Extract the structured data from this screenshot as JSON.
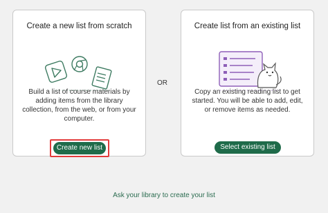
{
  "left_card": {
    "title": "Create a new list from scratch",
    "description": "Build a list of course materials by adding items from the library collection, from the web, or from your computer.",
    "button_label": "Create new list",
    "illustration_icons": [
      "play-icon",
      "chrome-icon",
      "document-icon"
    ]
  },
  "separator_label": "OR",
  "right_card": {
    "title": "Create list from an existing list",
    "description": "Copy an existing reading list to get started. You will be able to add, edit, or remove items as needed.",
    "button_label": "Select existing list",
    "illustration_icons": [
      "list-board-icon",
      "cat-icon"
    ]
  },
  "footer_link": "Ask your library to create your list",
  "colors": {
    "button_green": "#1f6b4a",
    "link_green": "#2a6b4f",
    "highlight_red": "#e23a3a",
    "list_purple": "#8e5fb8"
  }
}
